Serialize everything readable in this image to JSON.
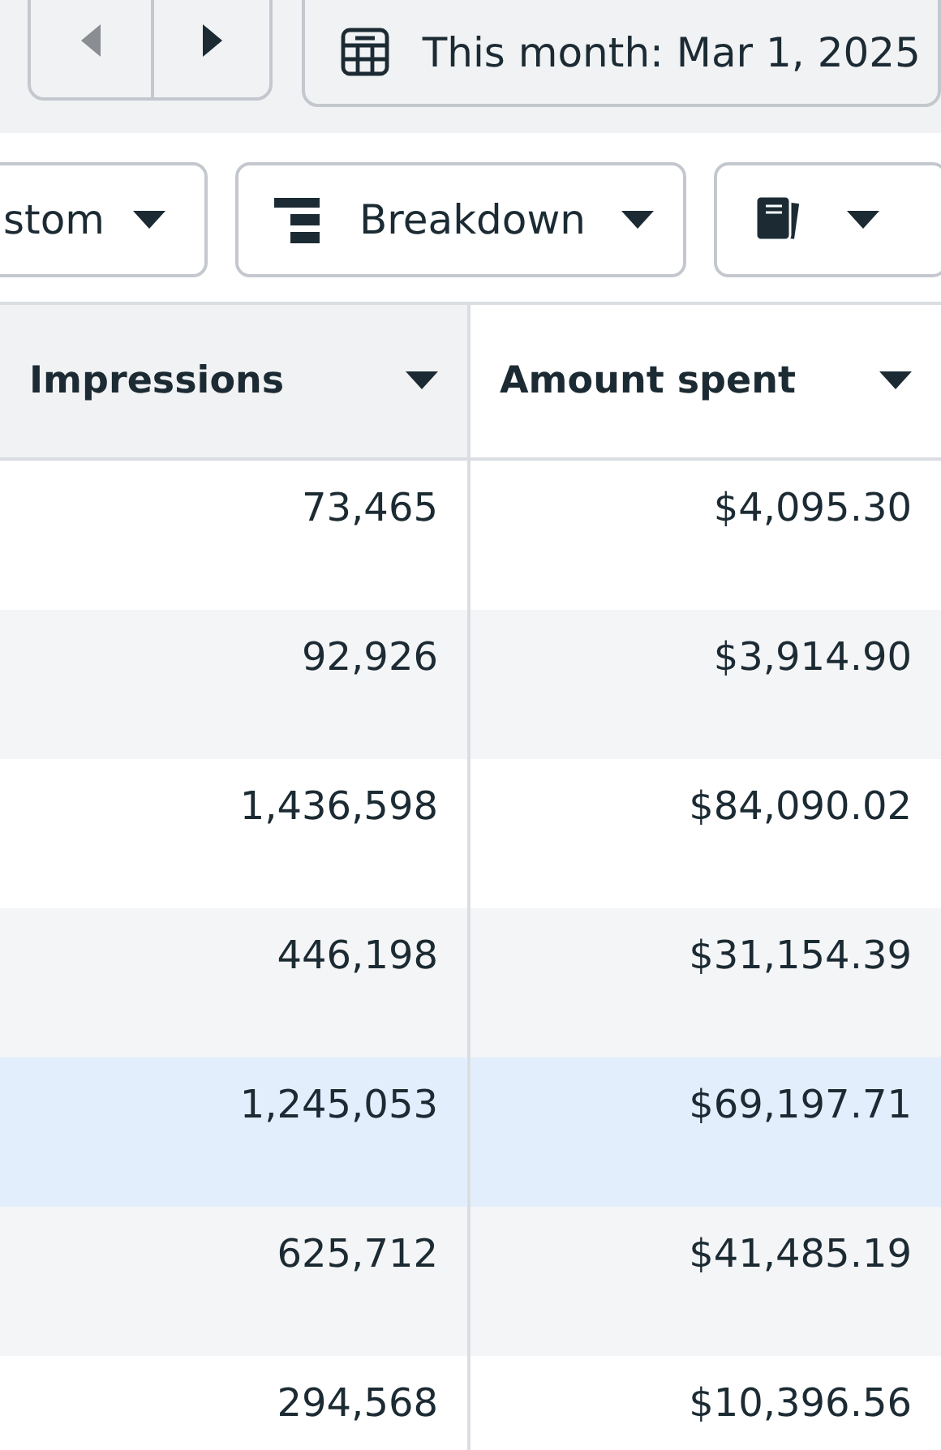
{
  "toolbar": {
    "previous_button": {
      "disabled": true
    },
    "next_button": {
      "disabled": false
    },
    "date_range": "This month: Mar 1, 2025"
  },
  "view_controls": [
    {
      "kind": "dropdown",
      "label": "stom"
    },
    {
      "kind": "breakdown",
      "label": "Breakdown"
    },
    {
      "kind": "reports"
    }
  ],
  "table": {
    "columns": [
      {
        "label": "Impressions",
        "sorted": true
      },
      {
        "label": "Amount spent",
        "sorted": false
      }
    ],
    "rows": [
      {
        "cells": [
          "73,465",
          "$4,095.30"
        ],
        "highlighted": false
      },
      {
        "cells": [
          "92,926",
          "$3,914.90"
        ],
        "highlighted": false
      },
      {
        "cells": [
          "1,436,598",
          "$84,090.02"
        ],
        "highlighted": false
      },
      {
        "cells": [
          "446,198",
          "$31,154.39"
        ],
        "highlighted": false
      },
      {
        "cells": [
          "1,245,053",
          "$69,197.71"
        ],
        "highlighted": true
      },
      {
        "cells": [
          "625,712",
          "$41,485.19"
        ],
        "highlighted": false
      },
      {
        "cells": [
          "294,568",
          "$10,396.56"
        ],
        "highlighted": false
      }
    ]
  }
}
